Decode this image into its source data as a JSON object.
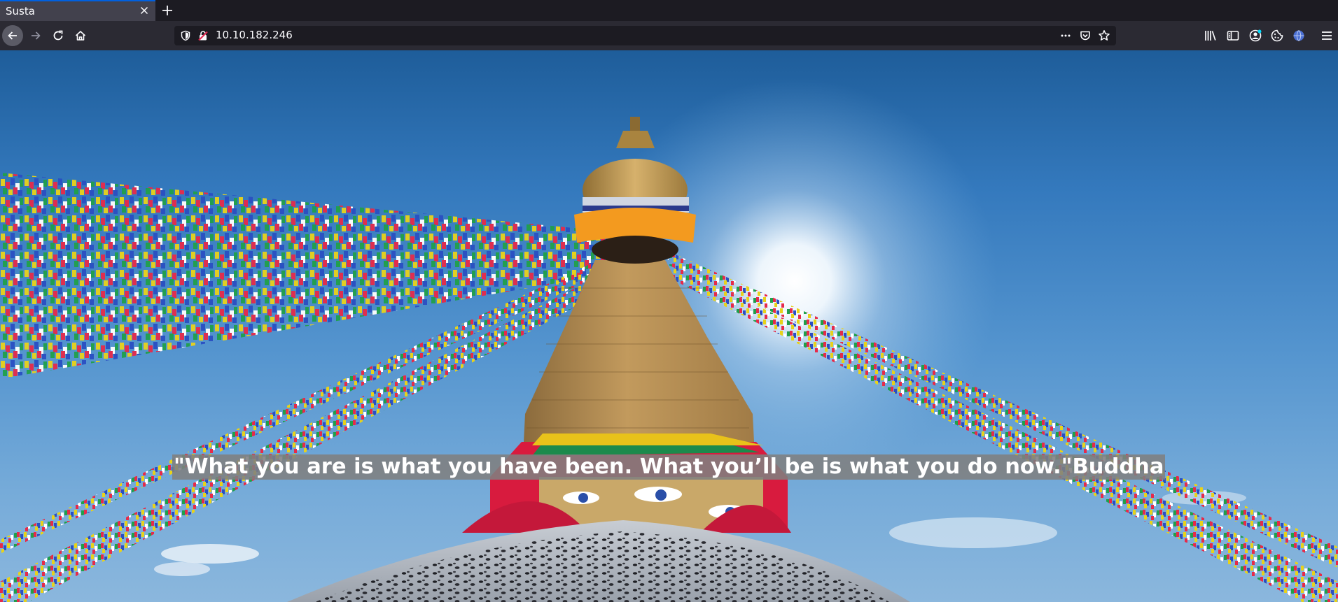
{
  "browser": {
    "tab": {
      "title": "Susta"
    },
    "address": {
      "url": "10.10.182.246"
    },
    "icons": {
      "back": "arrow-left-icon",
      "forward": "arrow-right-icon",
      "reload": "reload-icon",
      "home": "home-icon",
      "close_tab": "close-icon",
      "new_tab": "plus-icon",
      "site_info": "shield-icon",
      "connection": "insecure-lock-icon",
      "page_actions": "ellipsis-icon",
      "pocket": "pocket-icon",
      "bookmark": "star-icon",
      "library": "library-icon",
      "sidebar": "sidebar-icon",
      "account": "account-icon",
      "cookies": "cookie-icon",
      "extension": "globe-extension-icon",
      "menu": "hamburger-menu-icon"
    },
    "colors": {
      "tabstrip": "#1c1b22",
      "active_tab": "#42414d",
      "toolbar": "#2b2a33",
      "urlbar": "#1c1b22",
      "accent": "#0060df"
    }
  },
  "page": {
    "quote": "\"What you are is what you have been. What you’ll be is what you do now.\"Buddha",
    "background_image": "stupa-with-prayer-flags-image",
    "quote_background": "#808080"
  }
}
